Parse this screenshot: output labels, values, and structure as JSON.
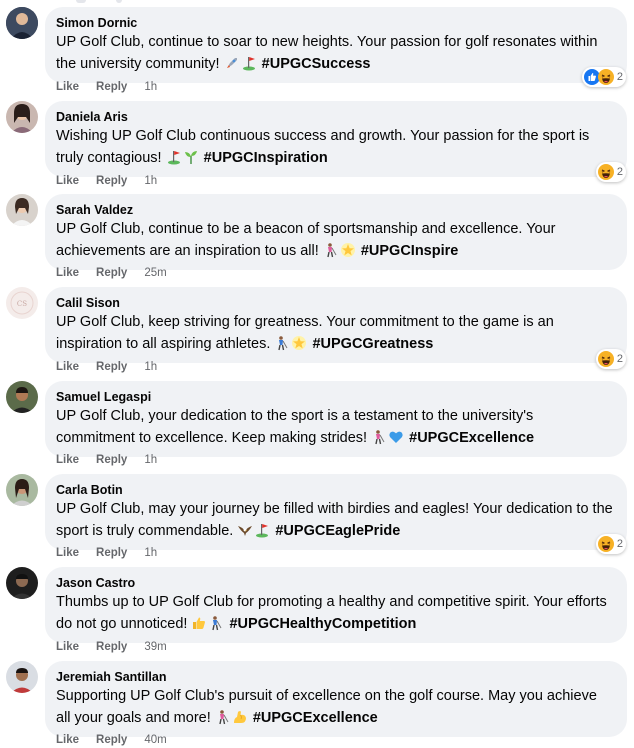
{
  "actions": {
    "like": "Like",
    "reply": "Reply"
  },
  "comments": [
    {
      "author": "Simon Dornic",
      "text": "UP Golf Club, continue to soar to new heights. Your passion for golf resonates within the university community!",
      "hashtag": "#UPGCSuccess",
      "emojis": [
        "rocket",
        "golf-flag"
      ],
      "time": "1h",
      "reaction_count": "2",
      "reactions": [
        "like",
        "haha"
      ]
    },
    {
      "author": "Daniela Aris",
      "text": "Wishing UP Golf Club continuous success and growth. Your passion for the sport is truly contagious!",
      "hashtag": "#UPGCInspiration",
      "emojis": [
        "golf-flag",
        "seedling"
      ],
      "time": "1h",
      "reaction_count": "2",
      "reactions": [
        "haha"
      ]
    },
    {
      "author": "Sarah Valdez",
      "text": "UP Golf Club, continue to be a beacon of sportsmanship and excellence. Your achievements are an inspiration to us all!",
      "hashtag": "#UPGCInspire",
      "emojis": [
        "golfer",
        "glowing-star"
      ],
      "time": "25m"
    },
    {
      "author": "Calil Sison",
      "text": "UP Golf Club, keep striving for greatness. Your commitment to the game is an inspiration to all aspiring athletes.",
      "hashtag": "#UPGCGreatness",
      "emojis": [
        "golfer",
        "glowing-star"
      ],
      "time": "1h",
      "reaction_count": "2",
      "reactions": [
        "haha"
      ]
    },
    {
      "author": "Samuel Legaspi",
      "text": "UP Golf Club, your dedication to the sport is a testament to the university's commitment to excellence. Keep making strides!",
      "hashtag": "#UPGCExcellence",
      "emojis": [
        "golfer",
        "blue-heart"
      ],
      "time": "1h"
    },
    {
      "author": "Carla Botin",
      "text": "UP Golf Club, may your journey be filled with birdies and eagles! Your dedication to the sport is truly commendable.",
      "hashtag": "#UPGCEaglePride",
      "emojis": [
        "eagle",
        "golf-flag"
      ],
      "time": "1h",
      "reaction_count": "2",
      "reactions": [
        "haha"
      ]
    },
    {
      "author": "Jason Castro",
      "text": "Thumbs up to UP Golf Club for promoting a healthy and competitive spirit. Your efforts do not go unnoticed!",
      "hashtag": "#UPGCHealthyCompetition",
      "emojis": [
        "thumbs-up",
        "golfer"
      ],
      "time": "39m"
    },
    {
      "author": "Jeremiah Santillan",
      "text": "Supporting UP Golf Club's pursuit of excellence on the golf course. May you achieve all your goals and more!",
      "hashtag": "#UPGCExcellence",
      "emojis": [
        "golfer",
        "flexed-biceps"
      ],
      "time": "40m"
    }
  ],
  "colors": {
    "bubble": "#f0f2f5",
    "meta": "#65676b",
    "like_blue": "#1877f2",
    "haha_yellow": "#f7b125"
  }
}
